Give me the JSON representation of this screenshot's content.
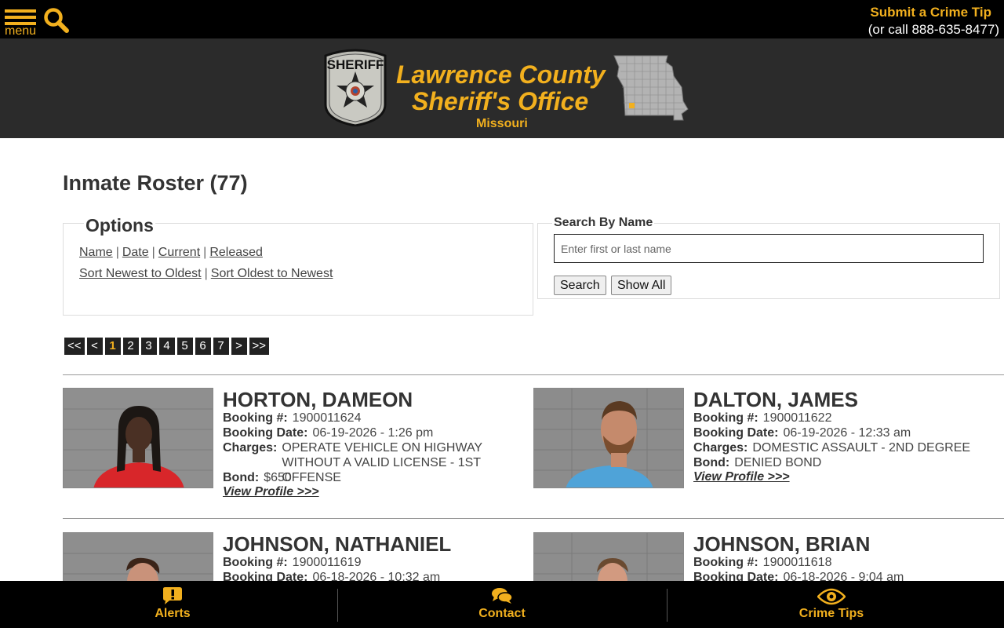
{
  "header": {
    "menu_label": "menu",
    "crime_tip_label": "Submit a Crime Tip",
    "crime_tip_phone": "(or call 888-635-8477)",
    "accent": "#f2b01e"
  },
  "banner": {
    "badge_text": "SHERIFF",
    "title_line1": "Lawrence County",
    "title_line2": "Sheriff's Office",
    "state": "Missouri"
  },
  "page": {
    "title": "Inmate Roster (77)"
  },
  "options": {
    "legend": "Options",
    "filters": [
      "Name",
      "Date",
      "Current",
      "Released"
    ],
    "sorts": [
      "Sort Newest to Oldest",
      "Sort Oldest to Newest"
    ]
  },
  "search": {
    "legend": "Search By Name",
    "placeholder": "Enter first or last name",
    "search_label": "Search",
    "show_all_label": "Show All"
  },
  "pagination": [
    "<<",
    "<",
    "1",
    "2",
    "3",
    "4",
    "5",
    "6",
    "7",
    ">",
    ">>"
  ],
  "pagination_current": "1",
  "labels": {
    "booking_no": "Booking #:",
    "booking_date": "Booking Date:",
    "charges": "Charges:",
    "bond": "Bond:",
    "view_profile": "View Profile >>>"
  },
  "inmates": [
    {
      "name": "HORTON, DAMEON",
      "booking_no": "1900011624",
      "booking_date": "06-19-2026 - 1:26 pm",
      "charges": "OPERATE VEHICLE ON HIGHWAY WITHOUT A VALID LICENSE - 1ST OFFENSE",
      "bond": "$650"
    },
    {
      "name": "DALTON, JAMES",
      "booking_no": "1900011622",
      "booking_date": "06-19-2026 - 12:33 am",
      "charges": "DOMESTIC ASSAULT - 2ND DEGREE",
      "bond": "DENIED BOND"
    },
    {
      "name": "JOHNSON, NATHANIEL",
      "booking_no": "1900011619",
      "booking_date": "06-18-2026 - 10:32 am"
    },
    {
      "name": "JOHNSON, BRIAN",
      "booking_no": "1900011618",
      "booking_date": "06-18-2026 - 9:04 am"
    }
  ],
  "bottom_nav": [
    "Alerts",
    "Contact",
    "Crime Tips"
  ]
}
